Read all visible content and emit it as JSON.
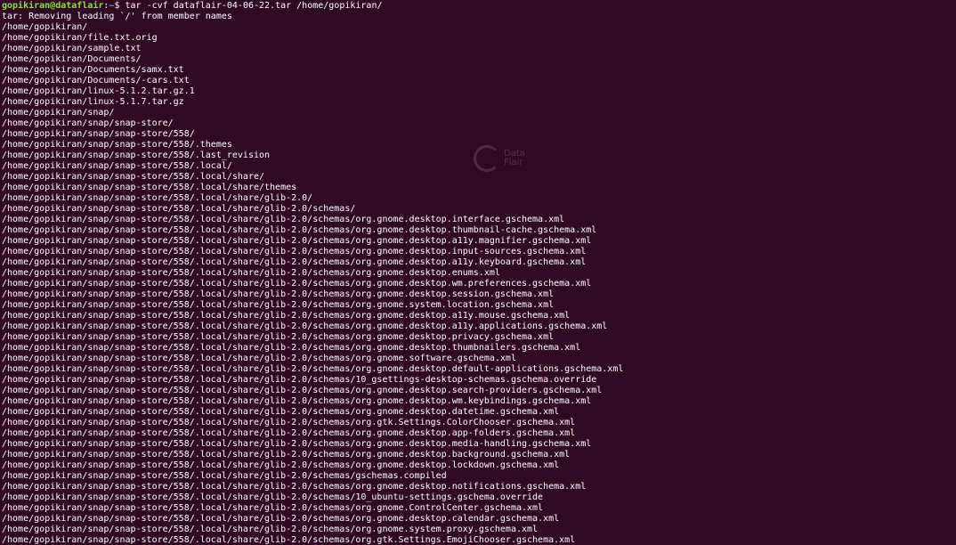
{
  "prompt": {
    "user_host": "gopikiran@dataflair",
    "separator": ":",
    "path": "~",
    "symbol": "$ ",
    "command": "tar -cvf dataflair-04-06-22.tar /home/gopikiran/"
  },
  "output_lines": [
    "tar: Removing leading `/' from member names",
    "/home/gopikiran/",
    "/home/gopikiran/file.txt.orig",
    "/home/gopikiran/sample.txt",
    "/home/gopikiran/Documents/",
    "/home/gopikiran/Documents/samx.txt",
    "/home/gopikiran/Documents/-cars.txt",
    "/home/gopikiran/linux-5.1.2.tar.gz.1",
    "/home/gopikiran/linux-5.1.7.tar.gz",
    "/home/gopikiran/snap/",
    "/home/gopikiran/snap/snap-store/",
    "/home/gopikiran/snap/snap-store/558/",
    "/home/gopikiran/snap/snap-store/558/.themes",
    "/home/gopikiran/snap/snap-store/558/.last_revision",
    "/home/gopikiran/snap/snap-store/558/.local/",
    "/home/gopikiran/snap/snap-store/558/.local/share/",
    "/home/gopikiran/snap/snap-store/558/.local/share/themes",
    "/home/gopikiran/snap/snap-store/558/.local/share/glib-2.0/",
    "/home/gopikiran/snap/snap-store/558/.local/share/glib-2.0/schemas/",
    "/home/gopikiran/snap/snap-store/558/.local/share/glib-2.0/schemas/org.gnome.desktop.interface.gschema.xml",
    "/home/gopikiran/snap/snap-store/558/.local/share/glib-2.0/schemas/org.gnome.desktop.thumbnail-cache.gschema.xml",
    "/home/gopikiran/snap/snap-store/558/.local/share/glib-2.0/schemas/org.gnome.desktop.a11y.magnifier.gschema.xml",
    "/home/gopikiran/snap/snap-store/558/.local/share/glib-2.0/schemas/org.gnome.desktop.input-sources.gschema.xml",
    "/home/gopikiran/snap/snap-store/558/.local/share/glib-2.0/schemas/org.gnome.desktop.a11y.keyboard.gschema.xml",
    "/home/gopikiran/snap/snap-store/558/.local/share/glib-2.0/schemas/org.gnome.desktop.enums.xml",
    "/home/gopikiran/snap/snap-store/558/.local/share/glib-2.0/schemas/org.gnome.desktop.wm.preferences.gschema.xml",
    "/home/gopikiran/snap/snap-store/558/.local/share/glib-2.0/schemas/org.gnome.desktop.session.gschema.xml",
    "/home/gopikiran/snap/snap-store/558/.local/share/glib-2.0/schemas/org.gnome.system.location.gschema.xml",
    "/home/gopikiran/snap/snap-store/558/.local/share/glib-2.0/schemas/org.gnome.desktop.a11y.mouse.gschema.xml",
    "/home/gopikiran/snap/snap-store/558/.local/share/glib-2.0/schemas/org.gnome.desktop.a11y.applications.gschema.xml",
    "/home/gopikiran/snap/snap-store/558/.local/share/glib-2.0/schemas/org.gnome.desktop.privacy.gschema.xml",
    "/home/gopikiran/snap/snap-store/558/.local/share/glib-2.0/schemas/org.gnome.desktop.thumbnailers.gschema.xml",
    "/home/gopikiran/snap/snap-store/558/.local/share/glib-2.0/schemas/org.gnome.software.gschema.xml",
    "/home/gopikiran/snap/snap-store/558/.local/share/glib-2.0/schemas/org.gnome.desktop.default-applications.gschema.xml",
    "/home/gopikiran/snap/snap-store/558/.local/share/glib-2.0/schemas/10_gsettings-desktop-schemas.gschema.override",
    "/home/gopikiran/snap/snap-store/558/.local/share/glib-2.0/schemas/org.gnome.desktop.search-providers.gschema.xml",
    "/home/gopikiran/snap/snap-store/558/.local/share/glib-2.0/schemas/org.gnome.desktop.wm.keybindings.gschema.xml",
    "/home/gopikiran/snap/snap-store/558/.local/share/glib-2.0/schemas/org.gnome.desktop.datetime.gschema.xml",
    "/home/gopikiran/snap/snap-store/558/.local/share/glib-2.0/schemas/org.gtk.Settings.ColorChooser.gschema.xml",
    "/home/gopikiran/snap/snap-store/558/.local/share/glib-2.0/schemas/org.gnome.desktop.app-folders.gschema.xml",
    "/home/gopikiran/snap/snap-store/558/.local/share/glib-2.0/schemas/org.gnome.desktop.media-handling.gschema.xml",
    "/home/gopikiran/snap/snap-store/558/.local/share/glib-2.0/schemas/org.gnome.desktop.background.gschema.xml",
    "/home/gopikiran/snap/snap-store/558/.local/share/glib-2.0/schemas/org.gnome.desktop.lockdown.gschema.xml",
    "/home/gopikiran/snap/snap-store/558/.local/share/glib-2.0/schemas/gschemas.compiled",
    "/home/gopikiran/snap/snap-store/558/.local/share/glib-2.0/schemas/org.gnome.desktop.notifications.gschema.xml",
    "/home/gopikiran/snap/snap-store/558/.local/share/glib-2.0/schemas/10_ubuntu-settings.gschema.override",
    "/home/gopikiran/snap/snap-store/558/.local/share/glib-2.0/schemas/org.gnome.ControlCenter.gschema.xml",
    "/home/gopikiran/snap/snap-store/558/.local/share/glib-2.0/schemas/org.gnome.desktop.calendar.gschema.xml",
    "/home/gopikiran/snap/snap-store/558/.local/share/glib-2.0/schemas/org.gnome.system.proxy.gschema.xml",
    "/home/gopikiran/snap/snap-store/558/.local/share/glib-2.0/schemas/org.gtk.Settings.EmojiChooser.gschema.xml"
  ],
  "watermark": {
    "icon": "dataflair-logo-icon",
    "lines": [
      "Data",
      "Flair"
    ]
  },
  "colors": {
    "background": "#300a24",
    "user_host": "#8ae234",
    "path": "#729fcf",
    "text": "#ffffff"
  }
}
